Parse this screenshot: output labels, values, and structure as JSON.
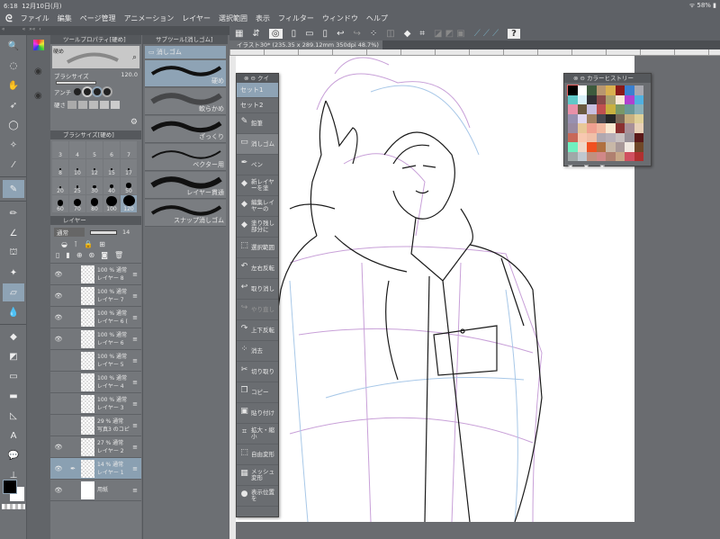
{
  "status": {
    "time": "6:18",
    "date": "12月10日(月)",
    "battery": "58%"
  },
  "menu": [
    "ファイル",
    "編集",
    "ページ管理",
    "アニメーション",
    "レイヤー",
    "選択範囲",
    "表示",
    "フィルター",
    "ウィンドウ",
    "ヘルプ"
  ],
  "tool_property": {
    "title": "ツールプロパティ[硬め]",
    "preset": "硬め",
    "brush_size_label": "ブラシサイズ",
    "brush_size_value": "120.0",
    "anti_label": "アンチ",
    "hardness_label": "硬さ"
  },
  "brush_size": {
    "title": "ブラシサイズ[硬め]",
    "sizes": [
      "3",
      "4",
      "5",
      "6",
      "7",
      "8",
      "10",
      "12",
      "15",
      "17",
      "20",
      "25",
      "30",
      "40",
      "50",
      "60",
      "70",
      "80",
      "100",
      "120"
    ]
  },
  "layers": {
    "tab": "レイヤー",
    "blend": "通常",
    "opacity": "14",
    "items": [
      {
        "top": "100 % 通常",
        "name": "レイヤー 8",
        "visible": true
      },
      {
        "top": "100 % 通常",
        "name": "レイヤー 7",
        "visible": true
      },
      {
        "top": "100 % 通常",
        "name": "レイヤー 6 (",
        "visible": true
      },
      {
        "top": "100 % 通常",
        "name": "レイヤー 6",
        "visible": true
      },
      {
        "top": "100 % 通常",
        "name": "レイヤー 5",
        "visible": false
      },
      {
        "top": "100 % 通常",
        "name": "レイヤー 4",
        "visible": false
      },
      {
        "top": "100 % 通常",
        "name": "レイヤー 3",
        "visible": false
      },
      {
        "top": "29 % 通常",
        "name": "写真3 のコピ",
        "visible": false
      },
      {
        "top": "27 % 通常",
        "name": "レイヤー 2",
        "visible": true
      },
      {
        "top": "14 % 通常",
        "name": "レイヤー 1",
        "visible": true,
        "selected": true
      },
      {
        "top": "",
        "name": "用紙",
        "visible": true
      }
    ]
  },
  "subtool": {
    "title": "サブツール[消しゴム]",
    "group": "消しゴム",
    "items": [
      "硬め",
      "軟らかめ",
      "ざっくり",
      "ベクター用",
      "レイヤー貫通",
      "スナップ消しゴム"
    ]
  },
  "canvas": {
    "tab": "イラスト30* (235.35 x 289.12mm 350dpi 48.7%)"
  },
  "quick_access": {
    "title": "クイ",
    "sets": [
      "セット1",
      "セット2"
    ],
    "items": [
      {
        "icon": "✎",
        "label": "鉛筆"
      },
      {
        "icon": "▭",
        "label": "消しゴム",
        "sel": true
      },
      {
        "icon": "✒",
        "label": "ペン"
      },
      {
        "icon": "◆",
        "label": "新レイヤーを塗"
      },
      {
        "icon": "◆",
        "label": "編集レイヤーの"
      },
      {
        "icon": "◆",
        "label": "塗り残し部分に"
      },
      {
        "icon": "⬚",
        "label": "選択範囲"
      },
      {
        "icon": "↶",
        "label": "左右反転"
      },
      {
        "icon": "↩",
        "label": "取り消し"
      },
      {
        "icon": "↪",
        "label": "やり直し",
        "dim": true
      },
      {
        "icon": "↷",
        "label": "上下反転"
      },
      {
        "icon": "⁘",
        "label": "消去"
      },
      {
        "icon": "✂",
        "label": "切り取り"
      },
      {
        "icon": "❐",
        "label": "コピー"
      },
      {
        "icon": "▣",
        "label": "貼り付け"
      },
      {
        "icon": "⌗",
        "label": "拡大・縮小"
      },
      {
        "icon": "⬚",
        "label": "自由変形"
      },
      {
        "icon": "▦",
        "label": "メッシュ変形"
      },
      {
        "icon": "●",
        "label": "表示位置を"
      }
    ]
  },
  "color_history": {
    "title": "カラーヒストリー",
    "colors": [
      "#000000",
      "#ffffff",
      "#3d5a3d",
      "#b89670",
      "#d9b050",
      "#8a1a1a",
      "#3a7fd0",
      "#a8a8b0",
      "#60c8c8",
      "#d8f0f8",
      "#303035",
      "#8a4a4a",
      "#a8a070",
      "#f8e8d8",
      "#b040d0",
      "#50b0e0",
      "#e890a8",
      "#6a5a40",
      "#c8c0e0",
      "#c05050",
      "#c8b040",
      "#789868",
      "#6a9898",
      "#8ab0b8",
      "#9890b0",
      "#e0d8f0",
      "#a08060",
      "#484850",
      "#282828",
      "#7a6858",
      "#c8b080",
      "#e0d098",
      "#9a8aa0",
      "#e8c898",
      "#f0a090",
      "#f0b8a0",
      "#f8e8d0",
      "#8a3030",
      "#a89098",
      "#e8d0b8",
      "#c86858",
      "#f8c8b0",
      "#f0c0a8",
      "#b0a8b0",
      "#b8b0b8",
      "#c8c0c0",
      "#989098",
      "#5a1818",
      "#70f0c0",
      "#f0d8c8",
      "#f05020",
      "#b07040",
      "#c8b8a8",
      "#a89898",
      "#f0e8e0",
      "#704828",
      "#a0a8a8",
      "#c0c8d0",
      "#c09080",
      "#d08888",
      "#b08070",
      "#c8a888",
      "#d05060",
      "#b03030"
    ]
  },
  "colors": {
    "accent": "#8ea3b5",
    "panel": "#74777b",
    "paper": "#ffffff",
    "line": "#1a1a1a",
    "sketch_purple": "#c8a0d8",
    "sketch_blue": "#a8c8e8"
  }
}
